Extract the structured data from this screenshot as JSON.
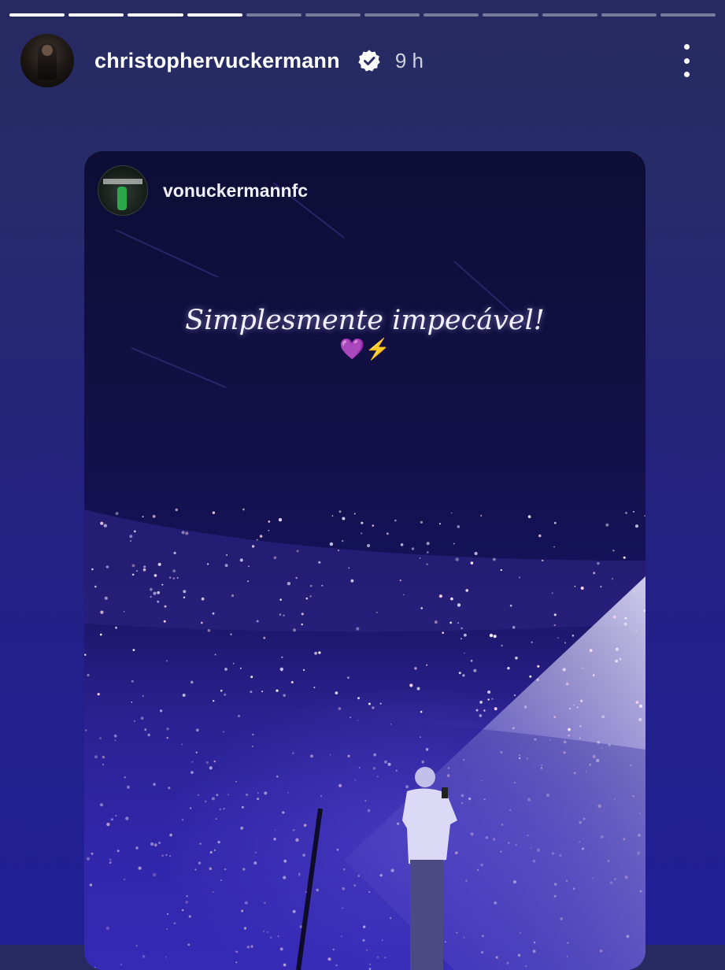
{
  "story": {
    "progress": {
      "total_segments": 12,
      "completed_segments": 4
    },
    "author": {
      "username": "christophervuckermann",
      "verified": true,
      "time_ago": "9 h"
    },
    "menu_icon": "more-vertical-icon"
  },
  "shared_post": {
    "username": "vonuckermannfc",
    "caption": "Simplesmente impecável!",
    "emojis": {
      "heart": "💜",
      "bolt": "⚡"
    }
  },
  "colors": {
    "background_top": "#272a60",
    "background_bottom": "#201f96",
    "verified_badge": "#ffffff",
    "stage_light": "#e7e4ff"
  }
}
